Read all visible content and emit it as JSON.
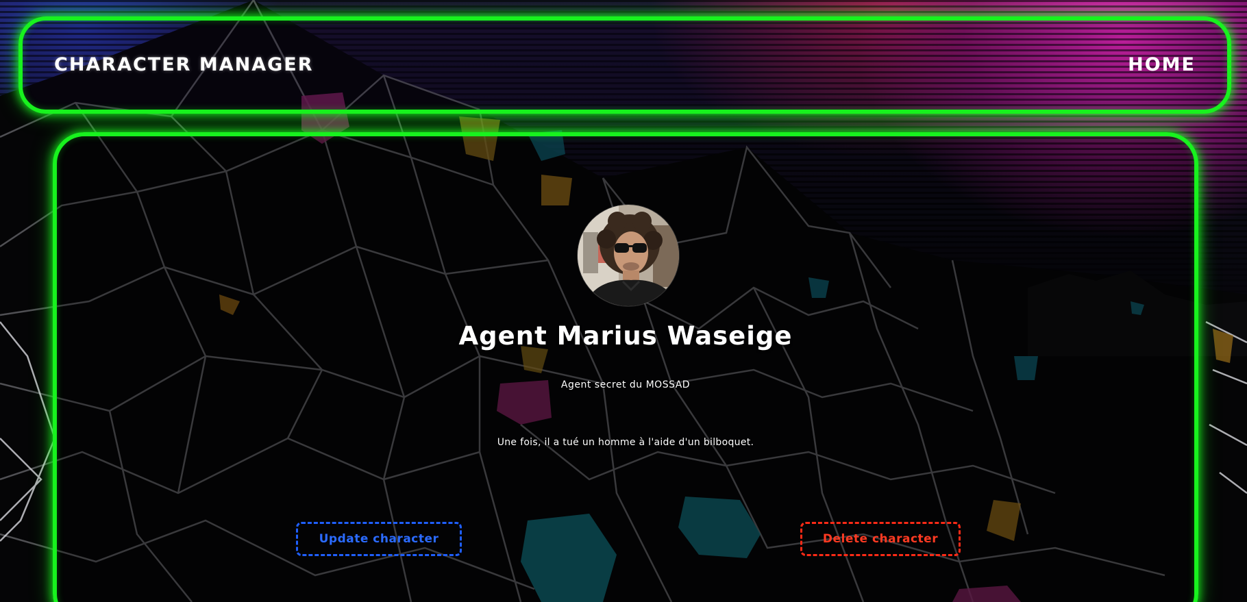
{
  "header": {
    "brand": "CHARACTER MANAGER",
    "nav": {
      "home_label": "HOME"
    }
  },
  "character": {
    "name": "Agent Marius Waseige",
    "title": "Agent secret du MOSSAD",
    "description": "Une fois, il a tué un homme à l'aide d'un bilboquet.",
    "avatar_icon": "avatar-photo"
  },
  "actions": {
    "update_label": "Update character",
    "delete_label": "Delete character"
  },
  "colors": {
    "accent_green": "#18f21e",
    "update_blue": "#2b6bff",
    "delete_red": "#ff3a22"
  }
}
